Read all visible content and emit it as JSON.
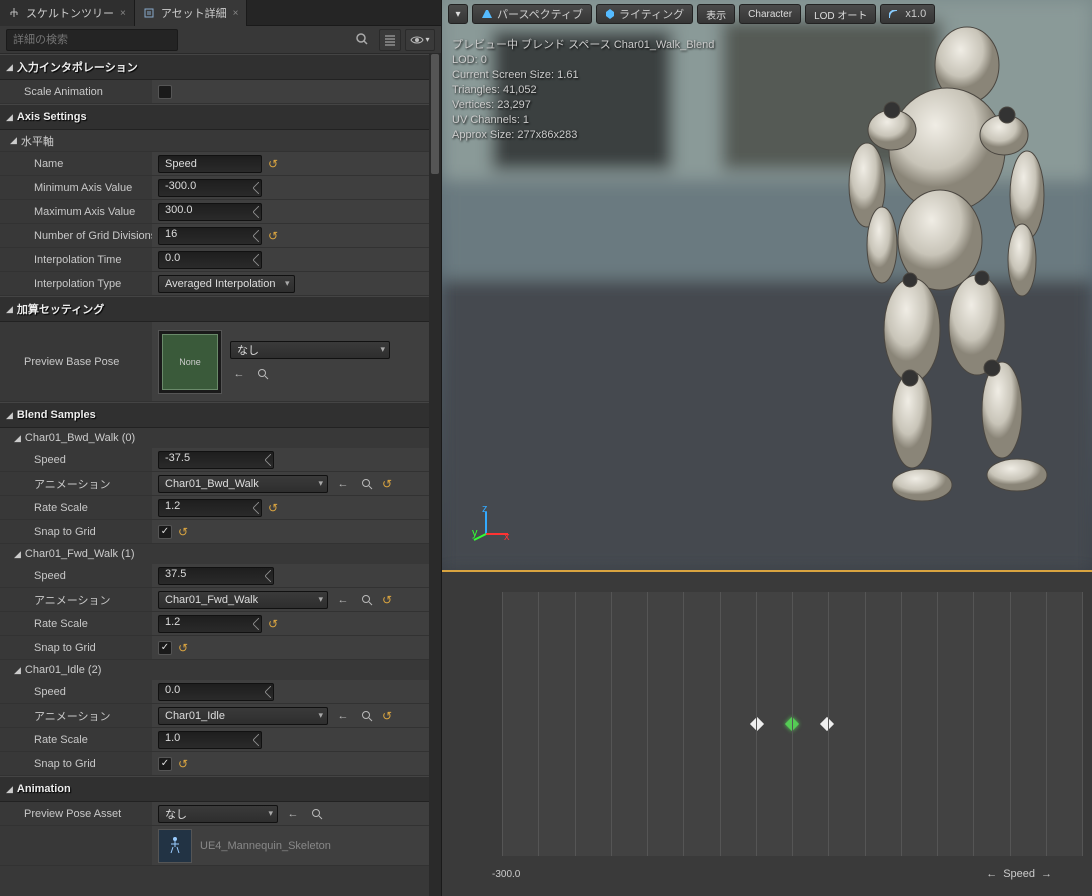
{
  "tabs": {
    "skeleton": "スケルトンツリー",
    "asset": "アセット詳細"
  },
  "search": {
    "placeholder": "詳細の検索"
  },
  "cat": {
    "input_interp": "入力インタポレーション",
    "axis_settings": "Axis Settings",
    "horizontal": "水平軸",
    "additive": "加算セッティング",
    "blend_samples": "Blend Samples",
    "animation": "Animation"
  },
  "props": {
    "scale_anim": "Scale Animation",
    "name": "Name",
    "name_val": "Speed",
    "min_axis": "Minimum Axis Value",
    "min_axis_val": "-300.0",
    "max_axis": "Maximum Axis Value",
    "max_axis_val": "300.0",
    "grid_div": "Number of Grid Divisions",
    "grid_div_val": "16",
    "interp_time": "Interpolation Time",
    "interp_time_val": "0.0",
    "interp_type": "Interpolation Type",
    "interp_type_val": "Averaged Interpolation",
    "preview_base": "Preview Base Pose",
    "none": "None",
    "nashi": "なし",
    "speed": "Speed",
    "anim": "アニメーション",
    "rate": "Rate Scale",
    "snap": "Snap to Grid",
    "preview_pose": "Preview Pose Asset",
    "skel_name": "UE4_Mannequin_Skeleton"
  },
  "samples": [
    {
      "name": "Char01_Bwd_Walk (0)",
      "speed": "-37.5",
      "anim": "Char01_Bwd_Walk",
      "rate": "1.2"
    },
    {
      "name": "Char01_Fwd_Walk (1)",
      "speed": "37.5",
      "anim": "Char01_Fwd_Walk",
      "rate": "1.2"
    },
    {
      "name": "Char01_Idle (2)",
      "speed": "0.0",
      "anim": "Char01_Idle",
      "rate": "1.0"
    }
  ],
  "viewport": {
    "btns": {
      "persp": "パースペクティブ",
      "lit": "ライティング",
      "show": "表示",
      "char": "Character",
      "lod": "LOD オート",
      "speed": "x1.0"
    },
    "stats": {
      "l1": "プレビュー中 ブレンド スペース Char01_Walk_Blend",
      "l2": "LOD: 0",
      "l3": "Current Screen Size: 1.61",
      "l4": "Triangles: 41,052",
      "l5": "Vertices: 23,297",
      "l6": "UV Channels: 1",
      "l7": "Approx Size: 277x86x283"
    }
  },
  "blend": {
    "min": "-300.0",
    "axis": "Speed"
  }
}
